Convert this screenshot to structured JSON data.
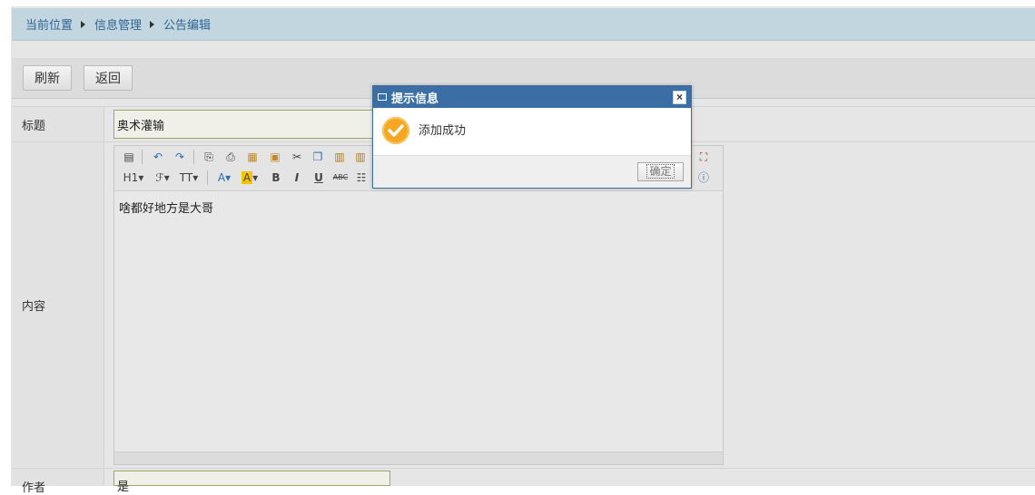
{
  "breadcrumb": [
    "当前位置",
    "信息管理",
    "公告编辑"
  ],
  "toolbar": {
    "refresh_label": "刷新",
    "back_label": "返回"
  },
  "form": {
    "title_label": "标题",
    "title_value": "奥术灌输",
    "content_label": "内容",
    "content_value": "啥都好地方是大哥",
    "author_label": "作者",
    "author_value": "是"
  },
  "editor_toolbar": {
    "heading_label": "H1",
    "font_label": "ℱ",
    "size_label": "TT",
    "font_color_label": "A",
    "highlight_label": "A",
    "bold_label": "B",
    "italic_label": "I",
    "underline_label": "U",
    "strike_label": "ABC"
  },
  "dialog": {
    "title": "提示信息",
    "message": "添加成功",
    "ok_label": "确定",
    "close_label": "×"
  },
  "colors": {
    "accent": "#3a6ea5",
    "breadcrumb_bg": "#c2d6e0",
    "success": "#f5a623"
  }
}
